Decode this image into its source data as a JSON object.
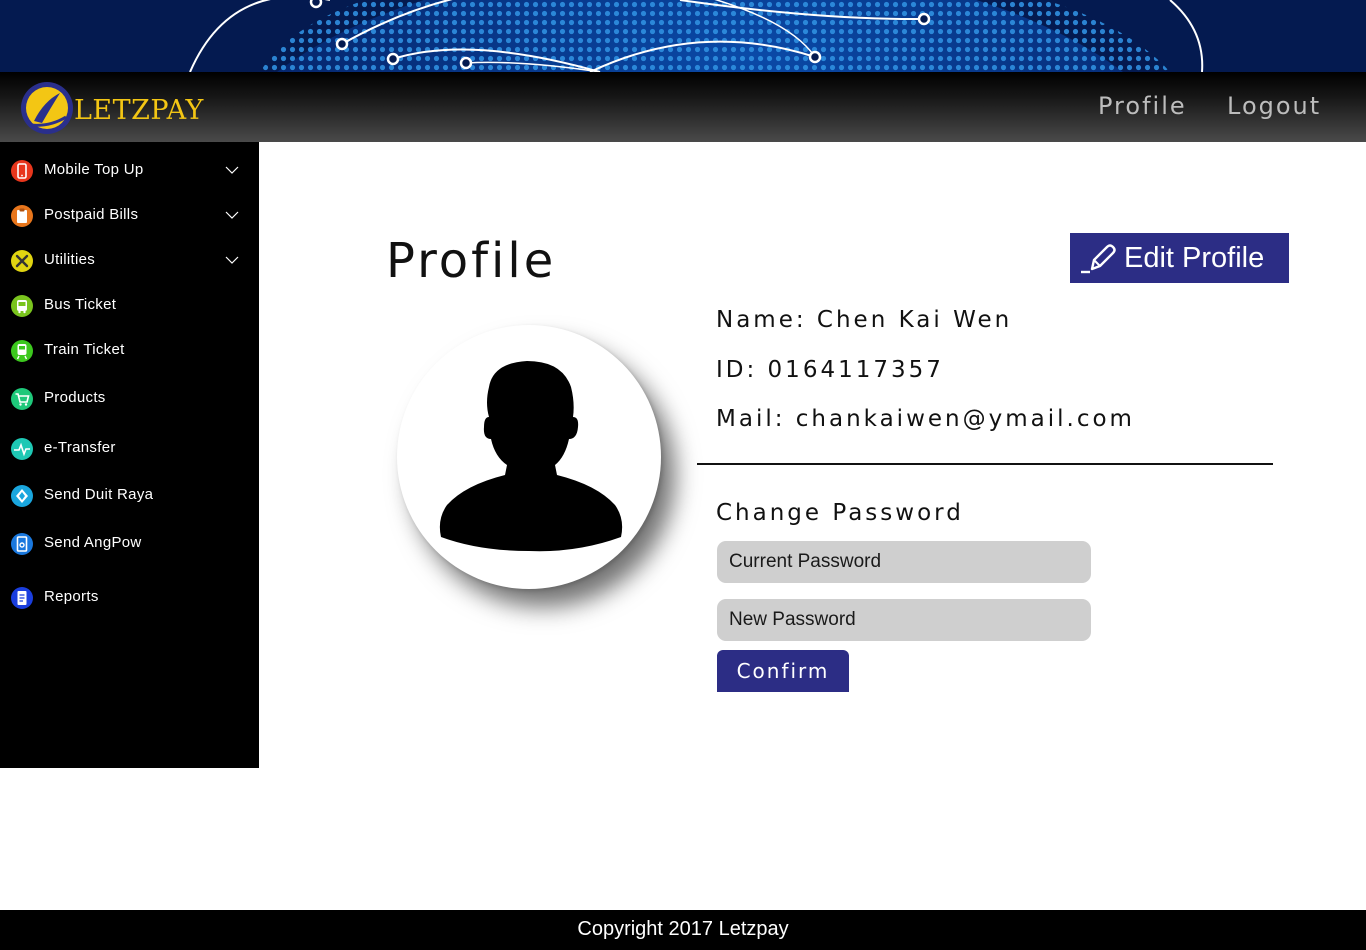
{
  "header": {
    "brand": "LETZPAY",
    "nav": {
      "profile": "Profile",
      "logout": "Logout"
    }
  },
  "sidebar": {
    "items": [
      {
        "label": "Mobile Top Up",
        "icon": "mobile-icon",
        "color": "#e8361c",
        "expandable": true
      },
      {
        "label": "Postpaid Bills",
        "icon": "clipboard-icon",
        "color": "#e8761c",
        "expandable": true
      },
      {
        "label": "Utilities",
        "icon": "tools-icon",
        "color": "#e0d411",
        "expandable": true
      },
      {
        "label": "Bus Ticket",
        "icon": "bus-icon",
        "color": "#7ac41e",
        "expandable": false
      },
      {
        "label": "Train Ticket",
        "icon": "train-icon",
        "color": "#3cc81e",
        "expandable": false
      },
      {
        "label": "Products",
        "icon": "cart-icon",
        "color": "#1ec87a",
        "expandable": false
      },
      {
        "label": "e-Transfer",
        "icon": "transfer-icon",
        "color": "#1ec8b4",
        "expandable": false
      },
      {
        "label": "Send Duit Raya",
        "icon": "diamond-icon",
        "color": "#1aa6de",
        "expandable": false
      },
      {
        "label": "Send AngPow",
        "icon": "envelope-icon",
        "color": "#1a78de",
        "expandable": false
      },
      {
        "label": "Reports",
        "icon": "document-icon",
        "color": "#1a3ede",
        "expandable": false
      }
    ]
  },
  "main": {
    "title": "Profile",
    "edit_button": "Edit Profile",
    "name_line": "Name: Chen Kai Wen",
    "id_line": "ID: 0164117357",
    "mail_line": "Mail: chankaiwen@ymail.com",
    "change_password": {
      "heading": "Change Password",
      "current_placeholder": "Current Password",
      "new_placeholder": "New Password",
      "confirm": "Confirm"
    }
  },
  "footer": {
    "copyright": "Copyright 2017 Letzpay"
  },
  "colors": {
    "accent": "#2c2d85",
    "sidebar_bg": "#000000",
    "brand_gold": "#f3c614"
  }
}
